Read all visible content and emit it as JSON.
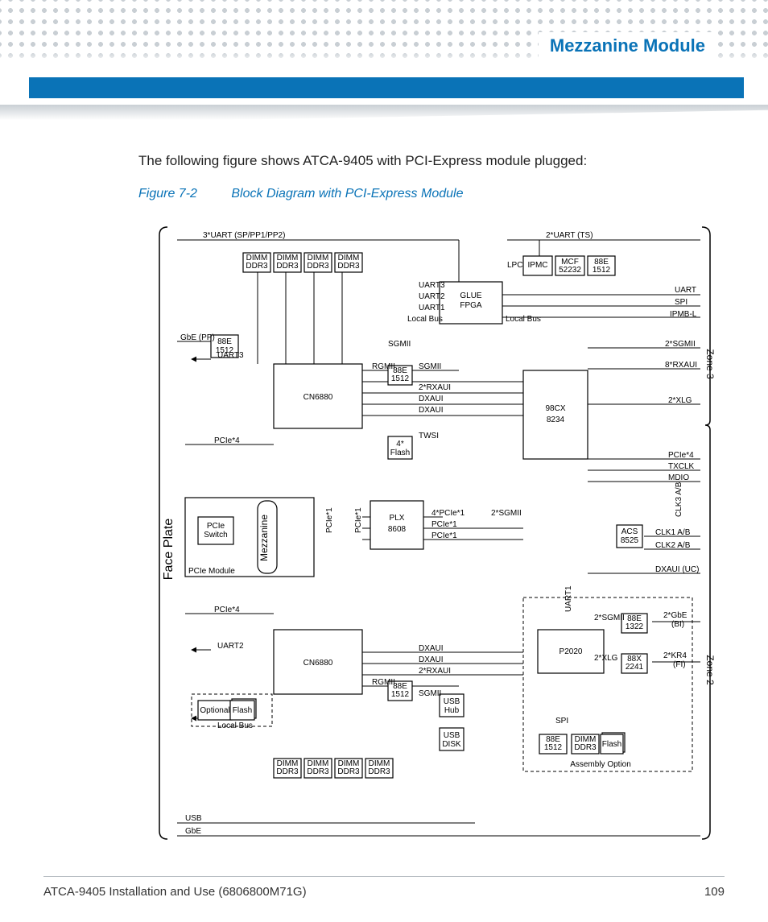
{
  "header": {
    "section_title": "Mezzanine Module"
  },
  "intro_text": "The following figure shows ATCA-9405 with PCI-Express module plugged:",
  "figure": {
    "number": "Figure 7-2",
    "title": "Block Diagram with PCI-Express Module"
  },
  "footer": {
    "doc": "ATCA-9405 Installation and Use (6806800M71G)",
    "page": "109"
  },
  "diagram": {
    "zones": {
      "left": "Face Plate",
      "right_top": "Zone 3",
      "right_bottom": "Zone 2"
    },
    "mezzanine_label": "Mezzanine",
    "pcie_module_label": "PCIe Module",
    "assembly_option_label": "Assembly Option",
    "blocks": {
      "glue_fpga": "GLUE\nFPGA",
      "cn6880_top": "CN6880",
      "cn6880_bot": "CN6880",
      "sw98cx": "98CX\n8234",
      "plx": "PLX\n8608",
      "p2020": "P2020",
      "flash4": "4*\nFlash",
      "pcie_switch": "PCIe\nSwitch",
      "ipmc": "IPMC",
      "mcf": "MCF\n52232",
      "e88_1512_a": "88E\n1512",
      "e88_1512_b": "88E\n1512",
      "e88_1512_c": "88E\n1512",
      "e88_1512_d": "88E\n1512",
      "e88_1512_e": "88E\n1512",
      "e88_1322": "88E\n1322",
      "x88_2241": "88X\n2241",
      "acs8525": "ACS\n8525",
      "usb_hub": "USB\nHub",
      "usb_disk": "USB\nDISK",
      "flash_opt": "Flash",
      "flash_p": "Flash",
      "optional": "Optional",
      "dimm": "DIMM\nDDR3"
    },
    "buses": [
      "3*UART (SP/PP1/PP2)",
      "2*UART (TS)",
      "LPC",
      "UART",
      "SPI",
      "IPMB-L",
      "UART3",
      "UART2",
      "UART1",
      "Local Bus",
      "SGMII",
      "RGMII",
      "2*RXAUI",
      "DXAUI",
      "TWSI",
      "4*PCIe*1",
      "PCIe*1",
      "PCIe*4",
      "2*SGMII",
      "8*RXAUI",
      "2*XLG",
      "TXCLK",
      "MDIO",
      "CLK3 A/B",
      "CLK1 A/B",
      "CLK2 A/B",
      "DXAUI (UC)",
      "2*GbE (BI)",
      "2*KR4 (FI)",
      "USB",
      "GbE",
      "GbE (PP)"
    ]
  }
}
